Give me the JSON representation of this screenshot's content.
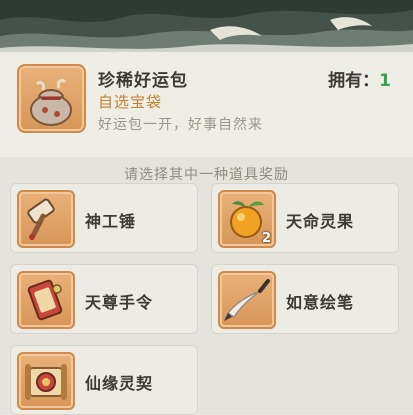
{
  "item": {
    "name": "珍稀好运包",
    "type": "自选宝袋",
    "description": "好运包一开，好事自然来",
    "icon": "lucky-bag-icon"
  },
  "owned": {
    "label": "拥有：",
    "count": "1"
  },
  "prompt": "请选择其中一种道具奖励",
  "options": [
    {
      "label": "神工锤",
      "icon": "hammer-icon",
      "quantity": ""
    },
    {
      "label": "天命灵果",
      "icon": "golden-fruit-icon",
      "quantity": "2"
    },
    {
      "label": "天尊手令",
      "icon": "decree-scroll-icon",
      "quantity": ""
    },
    {
      "label": "如意绘笔",
      "icon": "paint-brush-icon",
      "quantity": ""
    },
    {
      "label": "仙缘灵契",
      "icon": "contract-scroll-icon",
      "quantity": ""
    }
  ],
  "colors": {
    "accent_type": "#c4822e",
    "owned_count": "#3aa14f",
    "icon_frame": "#d79658"
  }
}
